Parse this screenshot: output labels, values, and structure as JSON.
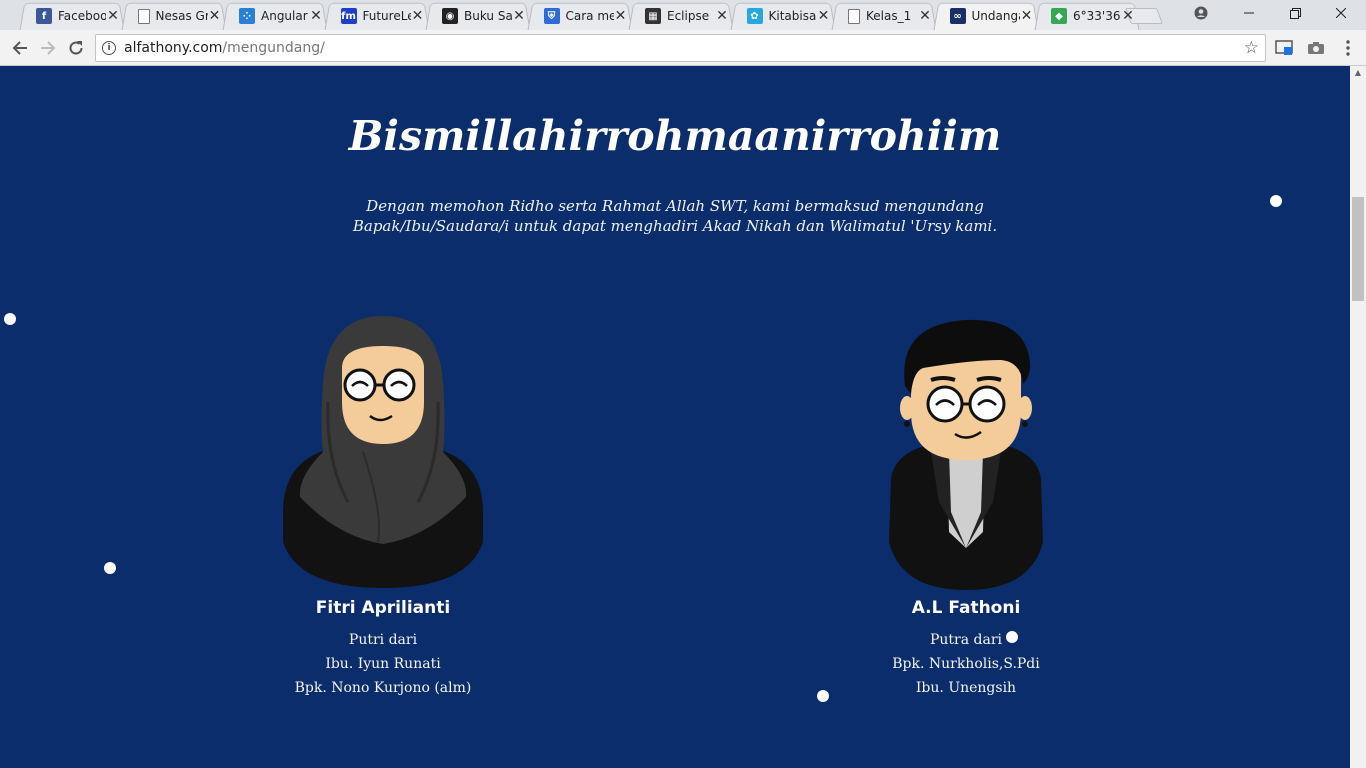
{
  "browser": {
    "tabs": [
      {
        "title": "Facebook",
        "icon": "facebook-icon",
        "color": "#3b5998",
        "glyph": "f"
      },
      {
        "title": "Nesas Gratis",
        "icon": "page-icon",
        "color": "#ffffff",
        "glyph": ""
      },
      {
        "title": "Angular",
        "icon": "angular-dots-icon",
        "color": "#2a7fd6",
        "glyph": "⁘"
      },
      {
        "title": "FutureLearn",
        "icon": "futurelearn-icon",
        "color": "#1f3fc9",
        "glyph": "fm"
      },
      {
        "title": "Buku Saku",
        "icon": "buku-icon",
        "color": "#222222",
        "glyph": "◉"
      },
      {
        "title": "Cara membuat",
        "icon": "shield-icon",
        "color": "#2e6bd6",
        "glyph": "⛨"
      },
      {
        "title": "Eclipse",
        "icon": "eclipse-icon",
        "color": "#333333",
        "glyph": "▦"
      },
      {
        "title": "Kitabisa",
        "icon": "kitabisa-icon",
        "color": "#22a9e0",
        "glyph": "✿"
      },
      {
        "title": "Kelas_1",
        "icon": "page-icon",
        "color": "#ffffff",
        "glyph": ""
      },
      {
        "title": "Undangan",
        "icon": "rings-icon",
        "color": "#1a2f66",
        "glyph": "∞",
        "active": true
      },
      {
        "title": "6°33'36",
        "icon": "maps-icon",
        "color": "#34a853",
        "glyph": "◆"
      }
    ],
    "url_host": "alfathony.com",
    "url_path": "/mengundang/"
  },
  "invitation": {
    "heading": "Bismillahirrohmaanirrohiim",
    "intro_line1": "Dengan memohon Ridho serta Rahmat Allah SWT, kami bermaksud mengundang",
    "intro_line2": "Bapak/Ibu/Saudara/i untuk dapat menghadiri Akad Nikah dan Walimatul 'Ursy kami.",
    "bride": {
      "name": "Fitri Aprilianti",
      "relation": "Putri dari",
      "parent1": "Ibu. Iyun Runati",
      "parent2": "Bpk. Nono Kurjono (alm)"
    },
    "groom": {
      "name": "A.L Fathoni",
      "relation": "Putra dari",
      "parent1": "Bpk. Nurkholis,S.Pdi",
      "parent2": "Ibu. Unengsih"
    }
  },
  "colors": {
    "background": "#0b2d6b",
    "text": "#ffffff"
  }
}
